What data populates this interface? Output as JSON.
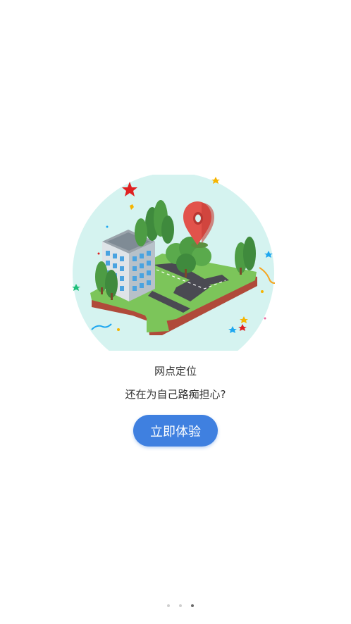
{
  "onboarding": {
    "title": "网点定位",
    "subtitle": "还在为自己路痴担心?",
    "cta_label": "立即体验",
    "illustration_icon": "city-map-pin-illustration"
  },
  "pager": {
    "count": 3,
    "active_index": 2
  },
  "colors": {
    "accent": "#3f80e0",
    "illustration_bg": "#d5f3f0",
    "grass": "#7cc55a",
    "pin": "#e2534b"
  }
}
